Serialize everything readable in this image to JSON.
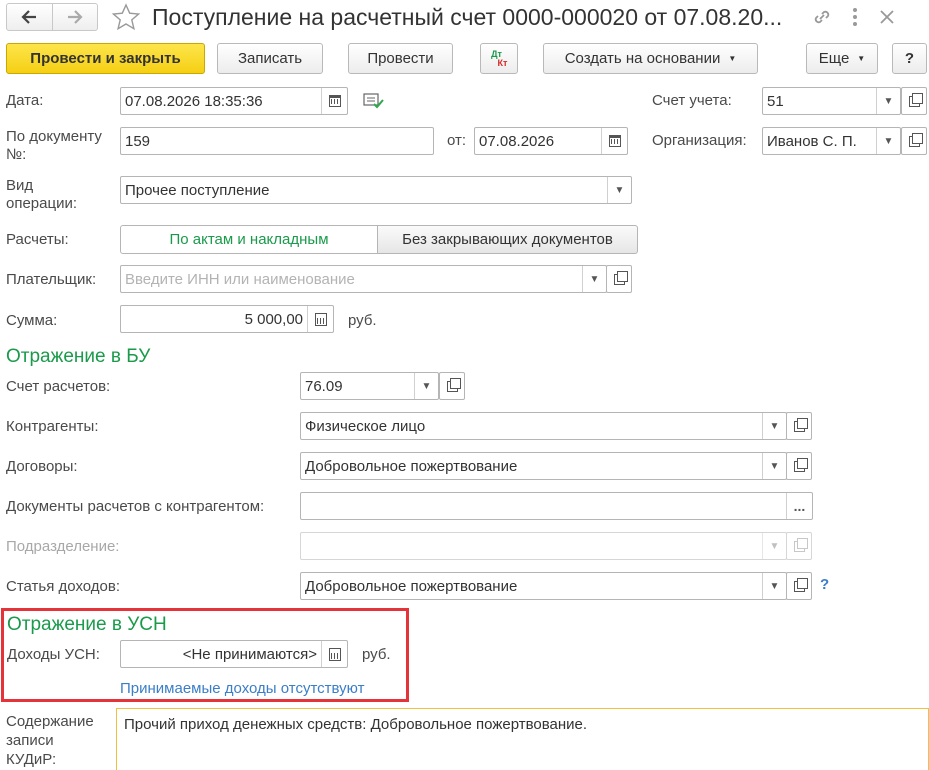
{
  "window": {
    "title": "Поступление на расчетный счет 0000-000020 от 07.08.20...",
    "nav_back_icon": "arrow-left-icon",
    "nav_forward_icon": "arrow-right-icon",
    "favorite_icon": "star-icon",
    "link_icon": "link-icon",
    "more_icon": "vertical-dots-icon",
    "close_icon": "close-icon"
  },
  "toolbar": {
    "post_close": "Провести и закрыть",
    "save": "Записать",
    "post": "Провести",
    "dtkt_top": "Дт",
    "dtkt_bottom": "Кт",
    "create_based": "Создать на основании",
    "more": "Еще",
    "help": "?"
  },
  "form": {
    "date_label": "Дата:",
    "date_value": "07.08.2026 18:35:36",
    "account_label": "Счет учета:",
    "account_value": "51",
    "doc_num_label_1": "По документу",
    "doc_num_label_2": "№:",
    "doc_num_value": "159",
    "from_label": "от:",
    "from_value": "07.08.2026",
    "org_label": "Организация:",
    "org_value": "Иванов С. П.",
    "op_type_label_1": "Вид",
    "op_type_label_2": "операции:",
    "op_type_value": "Прочее поступление",
    "settlements_label": "Расчеты:",
    "settlements_opt1": "По актам и накладным",
    "settlements_opt2": "Без закрывающих документов",
    "payer_label": "Плательщик:",
    "payer_placeholder": "Введите ИНН или наименование",
    "sum_label": "Сумма:",
    "sum_value": "5 000,00",
    "sum_currency": "руб."
  },
  "bu": {
    "title": "Отражение в БУ",
    "settl_account_label": "Счет расчетов:",
    "settl_account_value": "76.09",
    "counterparties_label": "Контрагенты:",
    "counterparties_value": "Физическое лицо",
    "contracts_label": "Договоры:",
    "contracts_value": "Добровольное пожертвование",
    "docs_label": "Документы расчетов с контрагентом:",
    "docs_value": "",
    "docs_btn": "...",
    "division_label": "Подразделение:",
    "division_value": "",
    "income_item_label": "Статья доходов:",
    "income_item_value": "Добровольное пожертвование",
    "help_mark": "?"
  },
  "usn": {
    "title": "Отражение в УСН",
    "income_label": "Доходы УСН:",
    "income_value": "<Не принимаются>",
    "income_currency": "руб.",
    "link": "Принимаемые доходы отсутствуют",
    "highlight_color": "#e5333a"
  },
  "kudir": {
    "label_1": "Содержание",
    "label_2": "записи",
    "label_3": "КУДиР:",
    "value": "Прочий приход денежных средств: Добровольное пожертвование."
  },
  "colors": {
    "section_green": "#1a9a4a",
    "primary_yellow": "#f5cf14",
    "link_blue": "#3a7ec9",
    "focus_orange": "#f0c040"
  }
}
